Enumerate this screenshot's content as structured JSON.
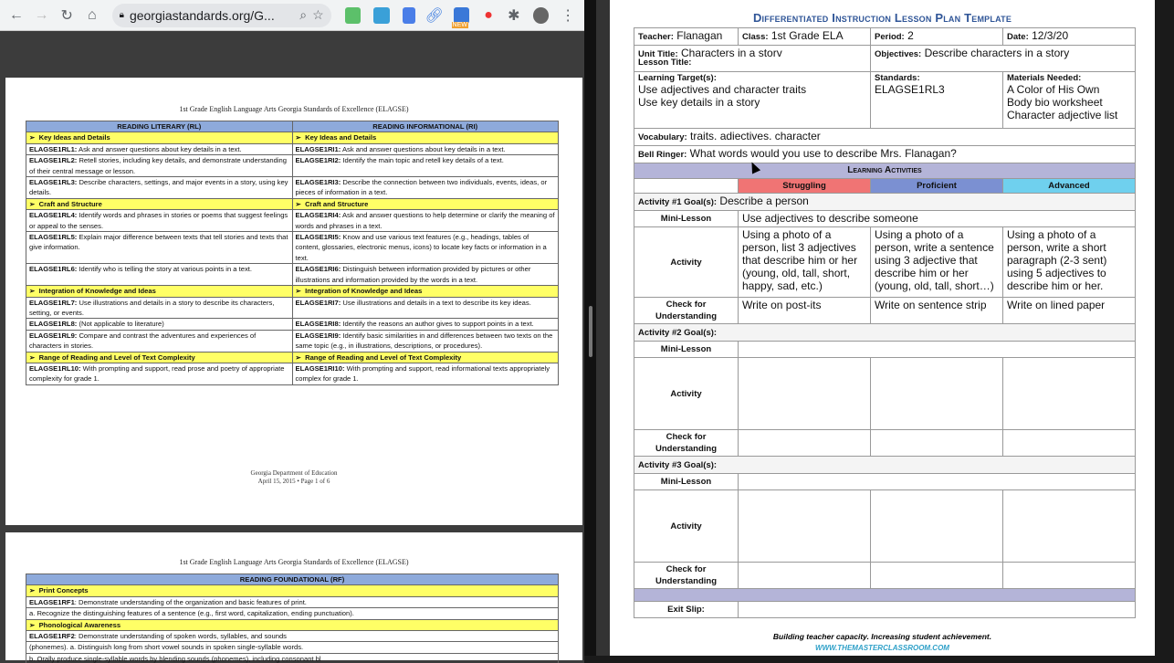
{
  "browser": {
    "url": "georgiastandards.org/G...",
    "ext_new_badge": "NEW"
  },
  "pdf": {
    "page1_title": "1st Grade English Language Arts Georgia Standards of Excellence (ELAGSE)",
    "rl_header": "READING LITERARY (RL)",
    "ri_header": "READING INFORMATIONAL (RI)",
    "rows": [
      {
        "type": "sub",
        "left": "Key Ideas and Details",
        "right": "Key Ideas and Details"
      },
      {
        "type": "std",
        "lcode": "ELAGSE1RL1:",
        "ltext": " Ask and answer questions about key details in a text.",
        "rcode": "ELAGSE1RI1:",
        "rtext": " Ask and answer questions about key details in a text."
      },
      {
        "type": "std",
        "lcode": "ELAGSE1RL2:",
        "ltext": " Retell stories, including key details, and demonstrate understanding of their central message or lesson.",
        "rcode": "ELAGSE1RI2:",
        "rtext": " Identify the main topic and retell key details of a text."
      },
      {
        "type": "std",
        "lcode": "ELAGSE1RL3:",
        "ltext": " Describe characters, settings, and major events in a story, using key details.",
        "rcode": "ELAGSE1RI3:",
        "rtext": " Describe the connection between two individuals, events, ideas, or pieces of information in a text."
      },
      {
        "type": "sub",
        "left": "Craft and Structure",
        "right": "Craft and Structure"
      },
      {
        "type": "std",
        "lcode": "ELAGSE1RL4:",
        "ltext": " Identify words and phrases in stories or poems that suggest feelings or appeal to the senses.",
        "rcode": "ELAGSE1RI4:",
        "rtext": " Ask and answer questions to help determine or clarify the meaning of words and phrases in a text."
      },
      {
        "type": "std",
        "lcode": "ELAGSE1RL5:",
        "ltext": " Explain major difference between texts that tell stories and texts that give information.",
        "rcode": "ELAGSE1RI5:",
        "rtext": " Know and use various text features (e.g., headings, tables of content, glossaries, electronic menus, icons) to locate key facts or information in a text."
      },
      {
        "type": "std",
        "lcode": "ELAGSE1RL6:",
        "ltext": " Identify who is telling the story at various points in a text.",
        "rcode": "ELAGSE1RI6:",
        "rtext": " Distinguish between information provided by pictures or other illustrations and information provided by the words in a text."
      },
      {
        "type": "sub",
        "left": "Integration of Knowledge and Ideas",
        "right": "Integration of Knowledge and Ideas"
      },
      {
        "type": "std",
        "lcode": "ELAGSE1RL7:",
        "ltext": " Use illustrations and details in a story to describe its characters, setting, or events.",
        "rcode": "ELAGSE1RI7:",
        "rtext": " Use illustrations and details in a text to describe its key ideas."
      },
      {
        "type": "std",
        "lcode": "ELAGSE1RL8:",
        "ltext": " (Not applicable to literature)",
        "rcode": "ELAGSE1RI8:",
        "rtext": " Identify the reasons an author gives to support points in a text."
      },
      {
        "type": "std",
        "lcode": "ELAGSE1RL9:",
        "ltext": "  Compare and contrast the adventures and experiences of characters in stories.",
        "rcode": "ELAGSE1RI9:",
        "rtext": " Identify basic similarities in and differences between two texts on the same topic (e.g., in illustrations, descriptions, or procedures)."
      },
      {
        "type": "sub",
        "left": "Range of Reading and Level of Text Complexity",
        "right": "Range of Reading and Level of Text Complexity"
      },
      {
        "type": "std",
        "lcode": "ELAGSE1RL10:",
        "ltext": " With prompting and support, read prose and poetry of appropriate complexity for grade 1.",
        "rcode": "ELAGSE1RI10:",
        "rtext": " With prompting and support, read informational texts appropriately complex for grade 1."
      }
    ],
    "footer1": "Georgia Department of Education",
    "footer2": "April 15, 2015 • Page 1 of 6",
    "page2_title": "1st Grade English Language Arts Georgia Standards of Excellence (ELAGSE)",
    "rf_header": "READING FOUNDATIONAL (RF)",
    "rf_rows": [
      {
        "type": "sub",
        "text": "Print Concepts"
      },
      {
        "type": "std",
        "code": "ELAGSE1RF1",
        "text": ": Demonstrate understanding of the organization and basic features of print."
      },
      {
        "type": "plain",
        "text": "a. Recognize the distinguishing features of a sentence (e.g., first word, capitalization, ending punctuation)."
      },
      {
        "type": "sub",
        "text": "Phonological Awareness"
      },
      {
        "type": "std",
        "code": "ELAGSE1RF2",
        "text": ": Demonstrate understanding of spoken words, syllables, and sounds"
      },
      {
        "type": "plain",
        "text": "(phonemes). a. Distinguish long from short vowel sounds in spoken single-syllable words."
      },
      {
        "type": "plain",
        "text": "b. Orally produce single-syllable words by blending sounds (phonemes), including consonant bl"
      }
    ]
  },
  "lesson": {
    "title": "Differentiated Instruction Lesson Plan Template",
    "teacher_label": "Teacher:",
    "teacher": "Flanagan",
    "class_label": "Class:",
    "class": "1st Grade ELA",
    "period_label": "Period:",
    "period": "2",
    "date_label": "Date:",
    "date": "12/3/20",
    "unit_label": "Unit Title:",
    "unit": "Characters in a storv",
    "lesson_label": "Lesson Title:",
    "objectives_label": "Objectives:",
    "objectives": "Describe characters in a story",
    "targets_label": "Learning Target(s):",
    "targets": [
      "Use adjectives and character traits",
      "Use key details in a story"
    ],
    "standards_label": "Standards:",
    "standards": "ELAGSE1RL3",
    "materials_label": "Materials Needed:",
    "materials": [
      "A Color of His Own",
      "Body bio worksheet",
      "Character adjective list"
    ],
    "vocab_label": "Vocabulary:",
    "vocab": "traits. adiectives. character",
    "bell_label": "Bell Ringer:",
    "bell": "What words would you use to describe Mrs. Flanagan?",
    "activities_header": "Learning Activities",
    "levels": [
      {
        "label": "Struggling",
        "color": "#f07474"
      },
      {
        "label": "Proficient",
        "color": "#7b90d2"
      },
      {
        "label": "Advanced",
        "color": "#6fd0ee"
      }
    ],
    "mini_label": "Mini-Lesson",
    "activity_label": "Activity",
    "check_label": "Check for Understanding",
    "activities": [
      {
        "goal_label": "Activity #1 Goal(s):",
        "goal": "Describe a person",
        "mini": "Use adjectives to describe someone",
        "activity": [
          "Using a photo of a person, list 3 adjectives that describe him or her (young, old, tall, short, happy, sad, etc.)",
          "Using a photo of a person, write a sentence using 3 adjective that describe him or her (young, old, tall, short…)",
          "Using a photo of a person, write a short paragraph (2-3 sent) using 5 adjectives to describe him or her."
        ],
        "check": [
          "Write on post-its",
          "Write on sentence strip",
          "Write on lined paper"
        ]
      },
      {
        "goal_label": "Activity #2 Goal(s):",
        "goal": "",
        "mini": "",
        "activity": [
          "",
          "",
          ""
        ],
        "check": [
          "",
          "",
          ""
        ]
      },
      {
        "goal_label": "Activity #3 Goal(s):",
        "goal": "",
        "mini": "",
        "activity": [
          "",
          "",
          ""
        ],
        "check": [
          "",
          "",
          ""
        ]
      }
    ],
    "exit_label": "Exit Slip:",
    "exit": "",
    "footer_tagline": "Building teacher capacity. Increasing student achievement.",
    "footer_url": "WWW.THEMASTERCLASSROOM.COM"
  }
}
